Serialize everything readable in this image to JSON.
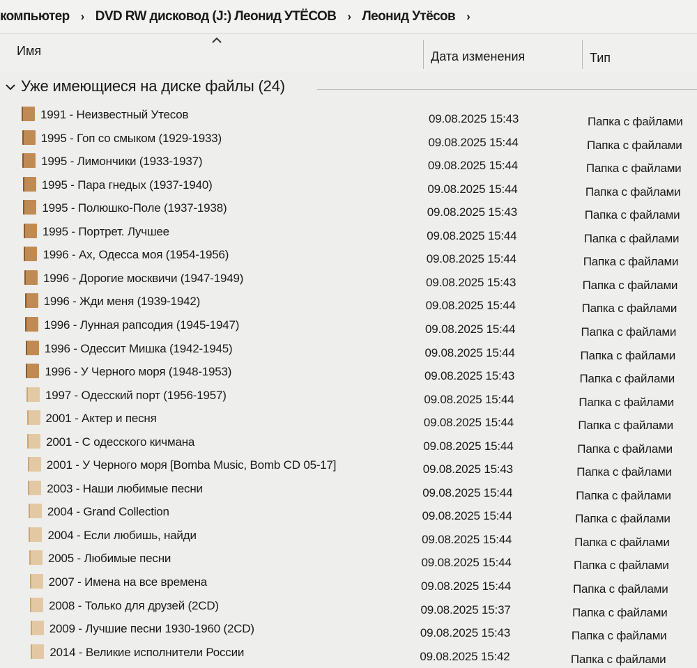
{
  "breadcrumb": [
    {
      "label": "компьютер"
    },
    {
      "label": "DVD RW дисковод (J:) Леонид УТЁСОВ"
    },
    {
      "label": "Леонид Утёсов"
    }
  ],
  "breadcrumb_separator": "›",
  "columns": {
    "name": "Имя",
    "date": "Дата изменения",
    "type": "Тип"
  },
  "group": {
    "title": "Уже имеющиеся на диске файлы (24)"
  },
  "colors": {
    "folder_light": "#e3c9a3",
    "folder_dark": "#c08a54",
    "text": "#1a1a1a"
  },
  "icons": {
    "folder": "folder-icon",
    "sort": "sort-ascending-icon",
    "group_toggle": "chevron-down-icon"
  },
  "files": [
    {
      "name": "1991 - Неизвестный Утесов",
      "date": "09.08.2025 15:43",
      "type": "Папка с файлами"
    },
    {
      "name": "1995 - Гоп со смыком (1929-1933)",
      "date": "09.08.2025 15:44",
      "type": "Папка с файлами"
    },
    {
      "name": "1995 - Лимончики (1933-1937)",
      "date": "09.08.2025 15:44",
      "type": "Папка с файлами"
    },
    {
      "name": "1995 - Пара гнедых (1937-1940)",
      "date": "09.08.2025 15:44",
      "type": "Папка с файлами"
    },
    {
      "name": "1995 - Полюшко-Поле (1937-1938)",
      "date": "09.08.2025 15:43",
      "type": "Папка с файлами"
    },
    {
      "name": "1995 - Портрет. Лучшее",
      "date": "09.08.2025 15:44",
      "type": "Папка с файлами"
    },
    {
      "name": "1996 - Ах, Одесса моя (1954-1956)",
      "date": "09.08.2025 15:44",
      "type": "Папка с файлами"
    },
    {
      "name": "1996 - Дорогие москвичи (1947-1949)",
      "date": "09.08.2025 15:43",
      "type": "Папка с файлами"
    },
    {
      "name": "1996 - Жди меня (1939-1942)",
      "date": "09.08.2025 15:44",
      "type": "Папка с файлами"
    },
    {
      "name": "1996 - Лунная рапсодия (1945-1947)",
      "date": "09.08.2025 15:44",
      "type": "Папка с файлами"
    },
    {
      "name": "1996 - Одессит Мишка (1942-1945)",
      "date": "09.08.2025 15:44",
      "type": "Папка с файлами"
    },
    {
      "name": "1996 - У Черного моря (1948-1953)",
      "date": "09.08.2025 15:43",
      "type": "Папка с файлами"
    },
    {
      "name": "1997 - Одесский порт (1956-1957)",
      "date": "09.08.2025 15:44",
      "type": "Папка с файлами"
    },
    {
      "name": "2001 - Актер и песня",
      "date": "09.08.2025 15:44",
      "type": "Папка с файлами"
    },
    {
      "name": "2001 - С одесского кичмана",
      "date": "09.08.2025 15:44",
      "type": "Папка с файлами"
    },
    {
      "name": "2001 - У Черного моря [Bomba Music, Bomb CD 05-17]",
      "date": "09.08.2025 15:43",
      "type": "Папка с файлами"
    },
    {
      "name": "2003 - Наши любимые песни",
      "date": "09.08.2025 15:44",
      "type": "Папка с файлами"
    },
    {
      "name": "2004 - Grand Collection",
      "date": "09.08.2025 15:44",
      "type": "Папка с файлами"
    },
    {
      "name": "2004 - Если любишь, найди",
      "date": "09.08.2025 15:44",
      "type": "Папка с файлами"
    },
    {
      "name": "2005 - Любимые песни",
      "date": "09.08.2025 15:44",
      "type": "Папка с файлами"
    },
    {
      "name": "2007 - Имена на все времена",
      "date": "09.08.2025 15:44",
      "type": "Папка с файлами"
    },
    {
      "name": "2008 - Только для друзей (2CD)",
      "date": "09.08.2025 15:37",
      "type": "Папка с файлами"
    },
    {
      "name": "2009 - Лучшие песни 1930-1960 (2CD)",
      "date": "09.08.2025 15:43",
      "type": "Папка с файлами"
    },
    {
      "name": "2014 - Великие исполнители России",
      "date": "09.08.2025 15:42",
      "type": "Папка с файлами"
    }
  ]
}
